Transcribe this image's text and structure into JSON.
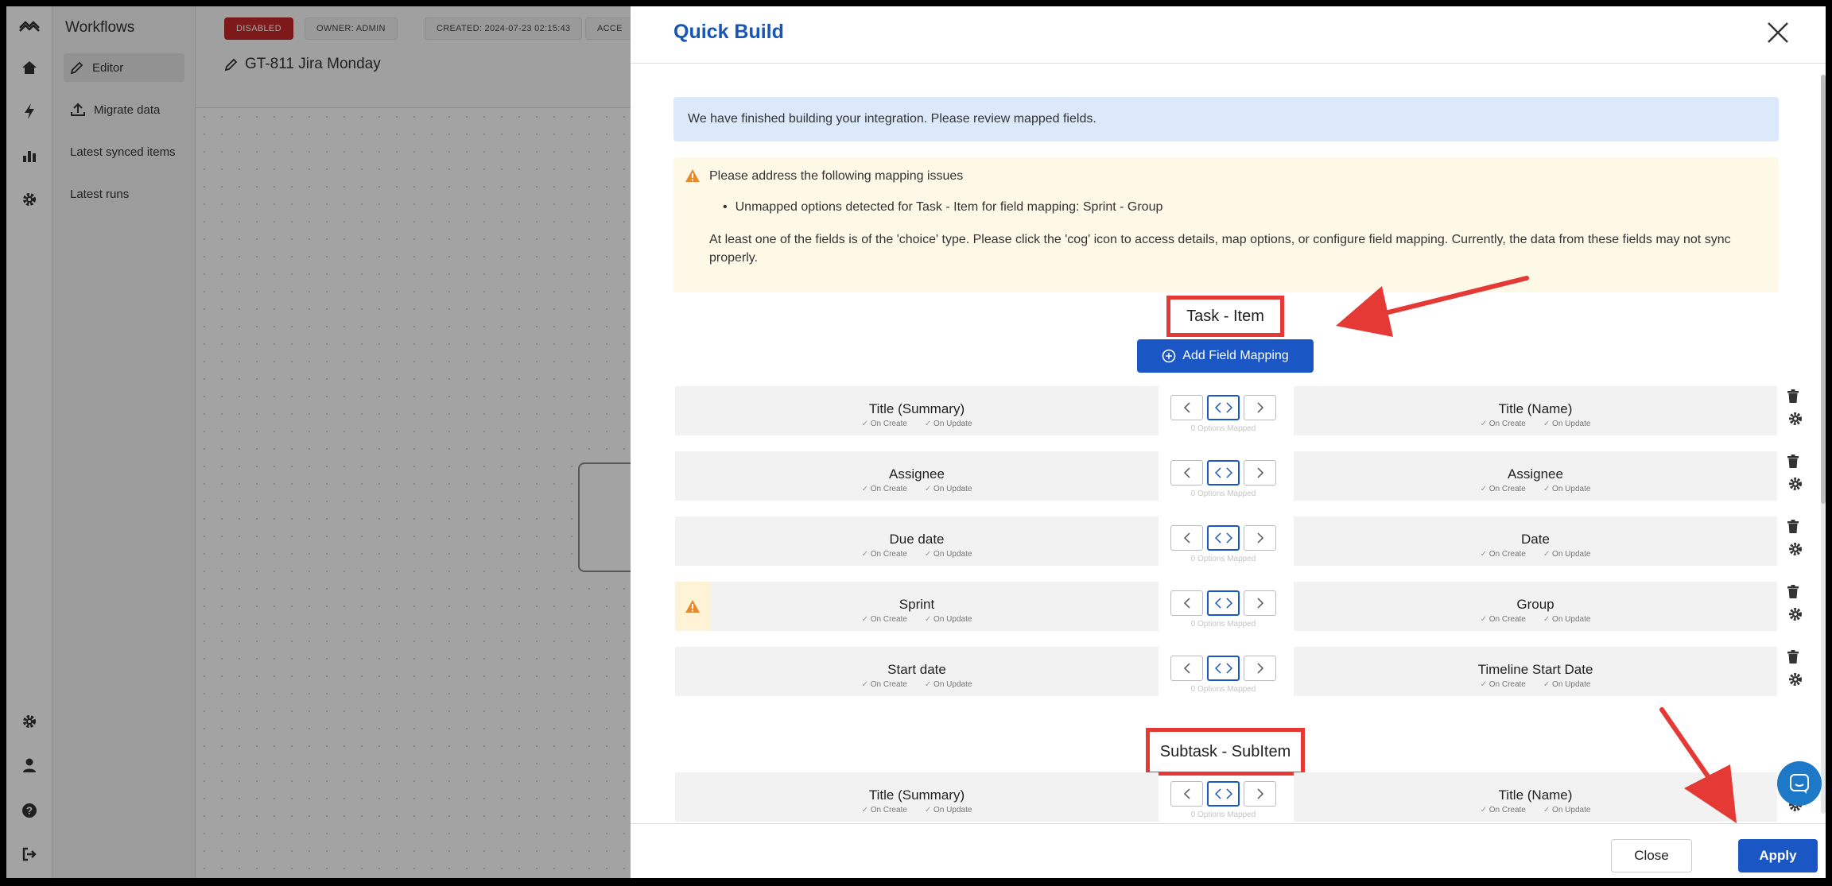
{
  "sidebar": {
    "title": "Workflows",
    "items": [
      {
        "label": "Editor",
        "icon": "pencil-icon"
      },
      {
        "label": "Migrate data",
        "icon": "upload-icon"
      },
      {
        "label": "Latest synced items"
      },
      {
        "label": "Latest runs"
      }
    ]
  },
  "topbar": {
    "status": "DISABLED",
    "owner": "OWNER: ADMIN",
    "created": "CREATED: 2024-07-23 02:15:43",
    "access": "ACCE",
    "workflow_name": "GT-811 Jira Monday"
  },
  "modal": {
    "title": "Quick Build",
    "info": "We have finished building your integration. Please review mapped fields.",
    "warning": {
      "heading": "Please address the following mapping issues",
      "bullet": "Unmapped options detected for Task - Item for field mapping: Sprint - Group",
      "detail": "At least one of the fields is of the 'choice' type. Please click the 'cog' icon to access details, map options, or configure field mapping. Currently, the data from these fields may not sync properly."
    },
    "groups": [
      {
        "title": "Task - Item"
      },
      {
        "title": "Subtask - SubItem"
      }
    ],
    "add_field_mapping": "Add Field Mapping",
    "flags": {
      "on_create": "On Create",
      "on_update": "On Update"
    },
    "options_mapped": "0 Options Mapped",
    "rows": [
      {
        "left": "Title (Summary)",
        "right": "Title (Name)"
      },
      {
        "left": "Assignee",
        "right": "Assignee"
      },
      {
        "left": "Due date",
        "right": "Date"
      },
      {
        "left": "Sprint",
        "right": "Group"
      },
      {
        "left": "Start date",
        "right": "Timeline Start Date"
      },
      {
        "left": "Title (Summary)",
        "right": "Title (Name)"
      }
    ],
    "close_label": "Close",
    "apply_label": "Apply"
  },
  "colors": {
    "accent": "#1a56c4",
    "title_blue": "#1756b5",
    "annotation_red": "#e53935",
    "disabled_red": "#c62828",
    "warning_bg": "#fef8e7",
    "info_bg": "#dce9fb"
  }
}
